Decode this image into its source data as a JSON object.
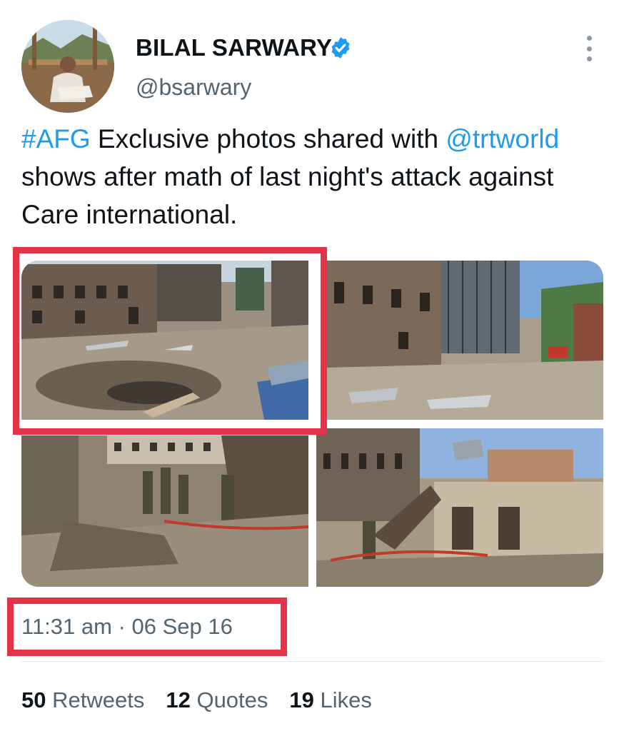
{
  "author": {
    "name": "BILAL SARWARY",
    "handle": "@bsarwary",
    "verified": true
  },
  "tweet": {
    "hashtag": "#AFG",
    "text_part1": " Exclusive photos shared with ",
    "mention": "@trtworld",
    "text_part2": " shows after math of last night's attack against Care international."
  },
  "timestamp": {
    "time": "11:31 am",
    "separator": "·",
    "date": "06 Sep 16"
  },
  "stats": {
    "retweets_count": "50",
    "retweets_label": "Retweets",
    "quotes_count": "12",
    "quotes_label": "Quotes",
    "likes_count": "19",
    "likes_label": "Likes"
  },
  "icons": {
    "verified": "verified-badge-icon",
    "more": "more-options-icon"
  },
  "colors": {
    "link": "#1d9bf0",
    "highlight": "#e23446",
    "muted": "#536471",
    "verified": "#1d9bf0"
  }
}
